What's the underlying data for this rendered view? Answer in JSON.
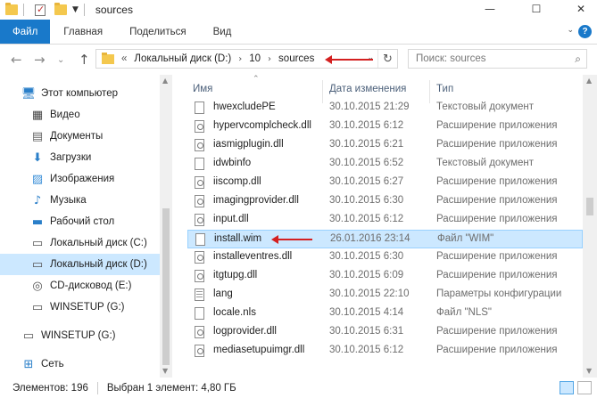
{
  "window": {
    "title": "sources",
    "minimize": "—",
    "maximize": "☐",
    "close": "✕"
  },
  "ribbon": {
    "tabs": [
      "Файл",
      "Главная",
      "Поделиться",
      "Вид"
    ],
    "toggle": "⌄",
    "help": "?"
  },
  "nav": {
    "back": "←",
    "forward": "→",
    "recent": "⌄",
    "up": "↑",
    "overflow": "«",
    "breadcrumb": [
      "Локальный диск (D:)",
      "10",
      "sources"
    ],
    "crumb_sep": "›",
    "dropdown": "⌄",
    "refresh": "↻",
    "search_placeholder": "Поиск: sources",
    "search_icon": "⌕"
  },
  "sidebar": {
    "items": [
      {
        "label": "Этот компьютер",
        "icon": "computer-icon",
        "glyph": "🖥"
      },
      {
        "label": "Видео",
        "icon": "video-icon",
        "glyph": "▦"
      },
      {
        "label": "Документы",
        "icon": "documents-icon",
        "glyph": "▤"
      },
      {
        "label": "Загрузки",
        "icon": "downloads-icon",
        "glyph": "⬇"
      },
      {
        "label": "Изображения",
        "icon": "pictures-icon",
        "glyph": "▨"
      },
      {
        "label": "Музыка",
        "icon": "music-icon",
        "glyph": "♪"
      },
      {
        "label": "Рабочий стол",
        "icon": "desktop-icon",
        "glyph": "▬"
      },
      {
        "label": "Локальный диск (C:)",
        "icon": "drive-c-icon",
        "glyph": "▭"
      },
      {
        "label": "Локальный диск (D:)",
        "icon": "drive-d-icon",
        "glyph": "▭"
      },
      {
        "label": "CD-дисковод (E:)",
        "icon": "cd-drive-icon",
        "glyph": "◎"
      },
      {
        "label": "WINSETUP (G:)",
        "icon": "usb-drive-icon",
        "glyph": "▭"
      },
      {
        "label": "WINSETUP (G:)",
        "icon": "usb-drive-icon",
        "glyph": "▭"
      },
      {
        "label": "Сеть",
        "icon": "network-icon",
        "glyph": "⊞"
      }
    ],
    "selected_index": 8
  },
  "columns": {
    "name": "Имя",
    "date": "Дата изменения",
    "type": "Тип"
  },
  "files": [
    {
      "name": "hwexcludePE",
      "date": "30.10.2015 21:29",
      "type": "Текстовый документ",
      "icon": "text-file-icon"
    },
    {
      "name": "hypervcomplcheck.dll",
      "date": "30.10.2015 6:12",
      "type": "Расширение приложения",
      "icon": "dll-file-icon"
    },
    {
      "name": "iasmigplugin.dll",
      "date": "30.10.2015 6:21",
      "type": "Расширение приложения",
      "icon": "dll-file-icon"
    },
    {
      "name": "idwbinfo",
      "date": "30.10.2015 6:52",
      "type": "Текстовый документ",
      "icon": "text-file-icon"
    },
    {
      "name": "iiscomp.dll",
      "date": "30.10.2015 6:27",
      "type": "Расширение приложения",
      "icon": "dll-file-icon"
    },
    {
      "name": "imagingprovider.dll",
      "date": "30.10.2015 6:30",
      "type": "Расширение приложения",
      "icon": "dll-file-icon"
    },
    {
      "name": "input.dll",
      "date": "30.10.2015 6:12",
      "type": "Расширение приложения",
      "icon": "dll-file-icon"
    },
    {
      "name": "install.wim",
      "date": "26.01.2016 23:14",
      "type": "Файл \"WIM\"",
      "icon": "wim-file-icon"
    },
    {
      "name": "installeventres.dll",
      "date": "30.10.2015 6:30",
      "type": "Расширение приложения",
      "icon": "dll-file-icon"
    },
    {
      "name": "itgtupg.dll",
      "date": "30.10.2015 6:09",
      "type": "Расширение приложения",
      "icon": "dll-file-icon"
    },
    {
      "name": "lang",
      "date": "30.10.2015 22:10",
      "type": "Параметры конфигурации",
      "icon": "config-file-icon"
    },
    {
      "name": "locale.nls",
      "date": "30.10.2015 4:14",
      "type": "Файл \"NLS\"",
      "icon": "nls-file-icon"
    },
    {
      "name": "logprovider.dll",
      "date": "30.10.2015 6:31",
      "type": "Расширение приложения",
      "icon": "dll-file-icon"
    },
    {
      "name": "mediasetupuimgr.dll",
      "date": "30.10.2015 6:12",
      "type": "Расширение приложения",
      "icon": "dll-file-icon"
    }
  ],
  "selected_file_index": 7,
  "status": {
    "count": "Элементов: 196",
    "selection": "Выбран 1 элемент: 4,80 ГБ"
  },
  "colors": {
    "accent": "#1979ca",
    "selection": "#cce8ff",
    "annotation": "#d42020"
  }
}
